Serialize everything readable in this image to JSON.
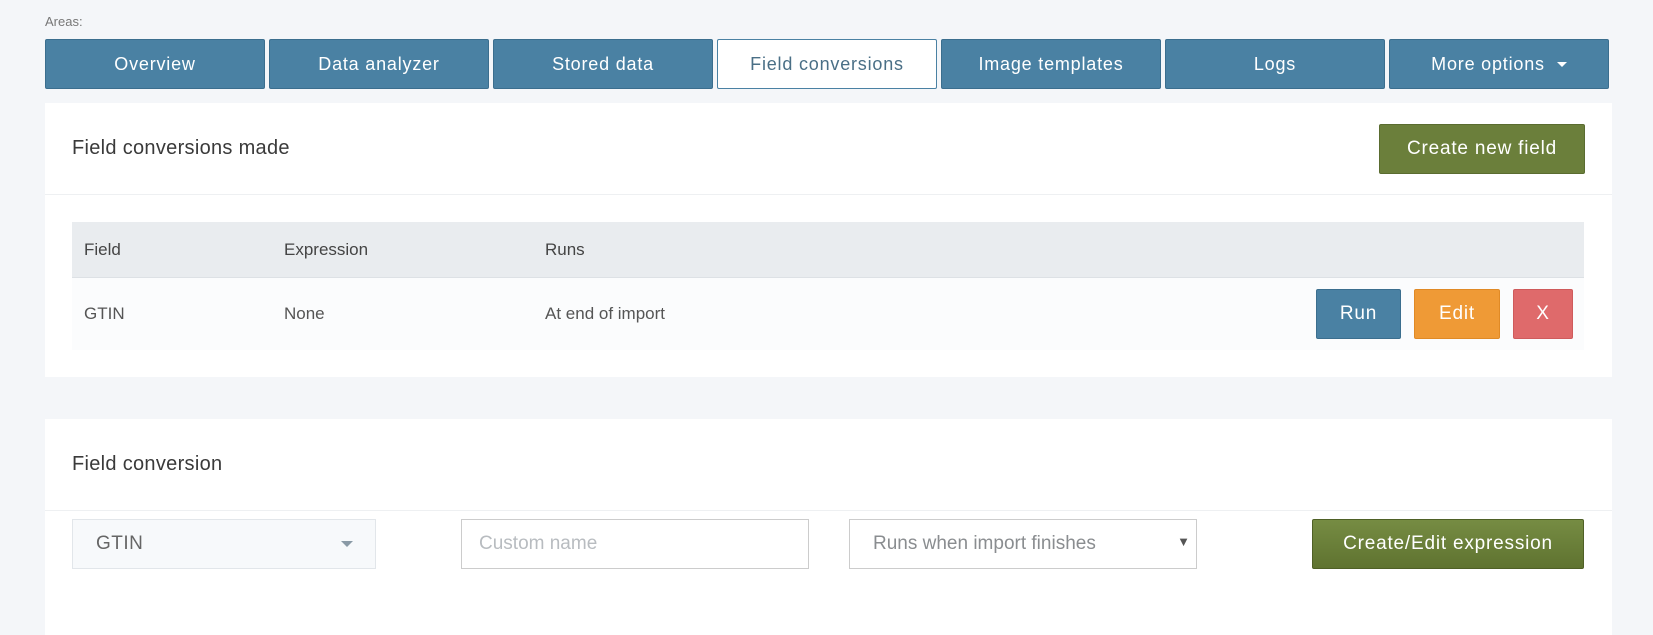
{
  "areas_label": "Areas:",
  "tabs": [
    {
      "label": "Overview"
    },
    {
      "label": "Data analyzer"
    },
    {
      "label": "Stored data"
    },
    {
      "label": "Field conversions"
    },
    {
      "label": "Image templates"
    },
    {
      "label": "Logs"
    },
    {
      "label": "More options"
    }
  ],
  "conversions_panel": {
    "title": "Field conversions made",
    "create_button": "Create new field",
    "columns": [
      "Field",
      "Expression",
      "Runs"
    ],
    "rows": [
      {
        "field": "GTIN",
        "expression": "None",
        "runs": "At end of import",
        "run_label": "Run",
        "edit_label": "Edit",
        "delete_label": "X"
      }
    ]
  },
  "conversion_form": {
    "title": "Field conversion",
    "field_select": "GTIN",
    "custom_name_placeholder": "Custom name",
    "runs_select": "Runs when import finishes",
    "expression_button": "Create/Edit expression"
  },
  "colors": {
    "primary": "#4a81a3",
    "success": "#6b7f3b",
    "warning": "#ef9a36",
    "danger": "#df6a6b"
  }
}
